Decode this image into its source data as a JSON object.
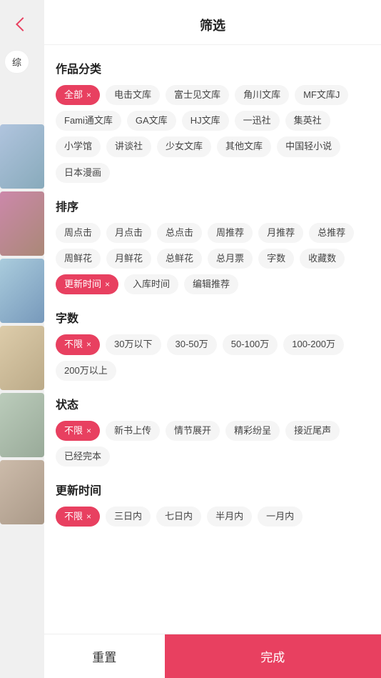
{
  "header": {
    "title": "筛选",
    "back_icon": "back"
  },
  "sidebar": {
    "back_label": "返回",
    "tab_label": "综",
    "images": [
      "img1",
      "img2",
      "img3",
      "img4",
      "img5",
      "img6"
    ]
  },
  "sections": [
    {
      "id": "category",
      "title": "作品分类",
      "tags": [
        {
          "label": "全部",
          "active": true
        },
        {
          "label": "电击文库",
          "active": false
        },
        {
          "label": "富士见文库",
          "active": false
        },
        {
          "label": "角川文库",
          "active": false
        },
        {
          "label": "MF文库J",
          "active": false
        },
        {
          "label": "Fami通文库",
          "active": false
        },
        {
          "label": "GA文库",
          "active": false
        },
        {
          "label": "HJ文库",
          "active": false
        },
        {
          "label": "一迅社",
          "active": false
        },
        {
          "label": "集英社",
          "active": false
        },
        {
          "label": "小学馆",
          "active": false
        },
        {
          "label": "讲谈社",
          "active": false
        },
        {
          "label": "少女文库",
          "active": false
        },
        {
          "label": "其他文库",
          "active": false
        },
        {
          "label": "中国轻小说",
          "active": false
        },
        {
          "label": "日本漫画",
          "active": false
        }
      ]
    },
    {
      "id": "sort",
      "title": "排序",
      "tags": [
        {
          "label": "周点击",
          "active": false
        },
        {
          "label": "月点击",
          "active": false
        },
        {
          "label": "总点击",
          "active": false
        },
        {
          "label": "周推荐",
          "active": false
        },
        {
          "label": "月推荐",
          "active": false
        },
        {
          "label": "总推荐",
          "active": false
        },
        {
          "label": "周鲜花",
          "active": false
        },
        {
          "label": "月鲜花",
          "active": false
        },
        {
          "label": "总鲜花",
          "active": false
        },
        {
          "label": "总月票",
          "active": false
        },
        {
          "label": "字数",
          "active": false
        },
        {
          "label": "收藏数",
          "active": false
        },
        {
          "label": "更新时间",
          "active": true
        },
        {
          "label": "入库时间",
          "active": false
        },
        {
          "label": "编辑推荐",
          "active": false
        }
      ]
    },
    {
      "id": "wordcount",
      "title": "字数",
      "tags": [
        {
          "label": "不限",
          "active": true
        },
        {
          "label": "30万以下",
          "active": false
        },
        {
          "label": "30-50万",
          "active": false
        },
        {
          "label": "50-100万",
          "active": false
        },
        {
          "label": "100-200万",
          "active": false
        },
        {
          "label": "200万以上",
          "active": false
        }
      ]
    },
    {
      "id": "status",
      "title": "状态",
      "tags": [
        {
          "label": "不限",
          "active": true
        },
        {
          "label": "新书上传",
          "active": false
        },
        {
          "label": "情节展开",
          "active": false
        },
        {
          "label": "精彩纷呈",
          "active": false
        },
        {
          "label": "接近尾声",
          "active": false
        },
        {
          "label": "已经完本",
          "active": false
        }
      ]
    },
    {
      "id": "update_time",
      "title": "更新时间",
      "tags": [
        {
          "label": "不限",
          "active": true
        },
        {
          "label": "三日内",
          "active": false
        },
        {
          "label": "七日内",
          "active": false
        },
        {
          "label": "半月内",
          "active": false
        },
        {
          "label": "一月内",
          "active": false
        }
      ]
    }
  ],
  "bottom": {
    "reset_label": "重置",
    "confirm_label": "完成"
  },
  "colors": {
    "accent": "#e84060"
  }
}
